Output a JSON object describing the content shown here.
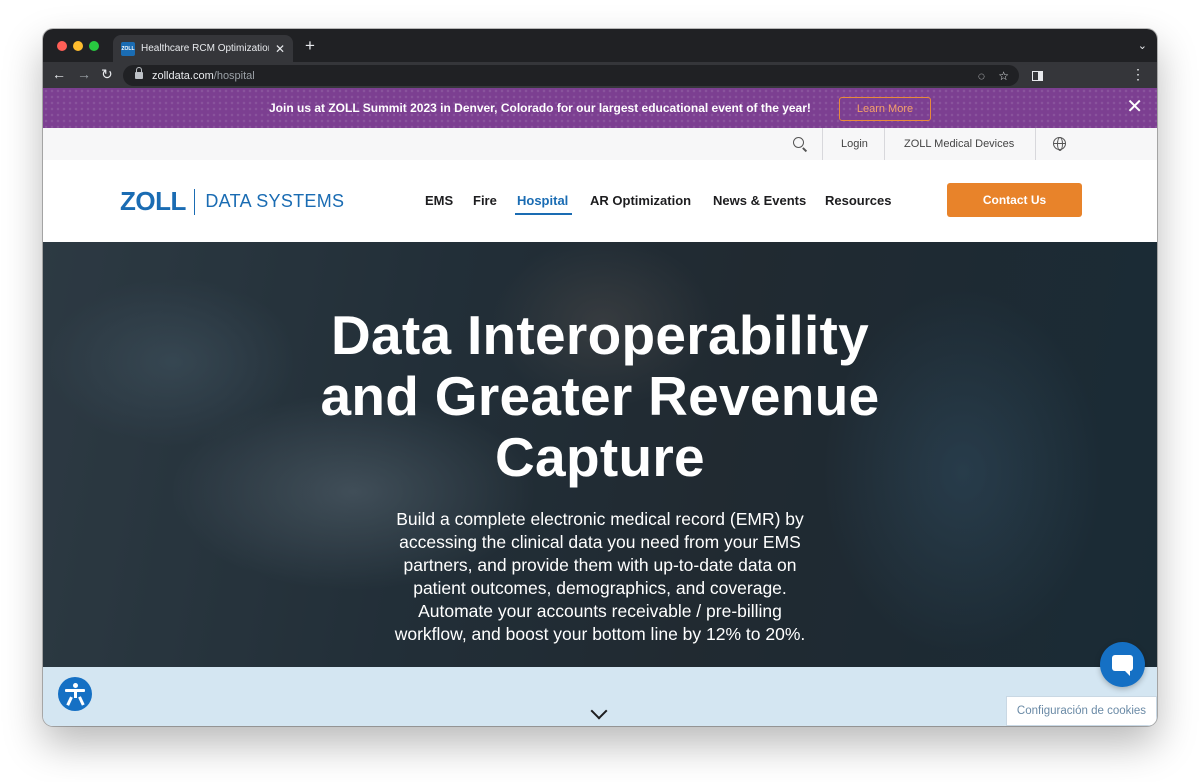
{
  "browser": {
    "tab_title": "Healthcare RCM Optimization |",
    "favicon_text": "ZOLL",
    "url_host": "zolldata.com",
    "url_path": "/hospital"
  },
  "promo": {
    "text": "Join us at ZOLL Summit 2023 in Denver, Colorado for our largest educational event of the year!",
    "button_label": "Learn More"
  },
  "utility": {
    "login": "Login",
    "devices": "ZOLL Medical Devices"
  },
  "header": {
    "logo_main": "ZOLL",
    "logo_sub": "DATA SYSTEMS",
    "nav": [
      {
        "label": "EMS"
      },
      {
        "label": "Fire"
      },
      {
        "label": "Hospital"
      },
      {
        "label": "AR Optimization"
      },
      {
        "label": "News & Events"
      },
      {
        "label": "Resources"
      }
    ],
    "active_nav": "Hospital",
    "contact_label": "Contact Us"
  },
  "hero": {
    "title": "Data Interoperability and Greater Revenue Capture",
    "body": "Build a complete electronic medical record (EMR) by accessing the clinical data you need from your EMS partners, and provide them with up-to-date data on patient outcomes, demographics, and coverage. Automate your accounts receivable / pre-billing workflow, and boost your bottom line by 12% to 20%."
  },
  "cookie": {
    "label": "Configuración de cookies"
  },
  "colors": {
    "brand_blue": "#1a6cb3",
    "promo_purple": "#7c3f91",
    "contact_orange": "#e8832a",
    "band_blue": "#d4e6f2"
  },
  "icons": {
    "search": "search-icon",
    "globe": "globe-icon",
    "accessibility": "accessibility-icon",
    "chat": "chat-icon",
    "scroll": "chevron-down-icon"
  }
}
